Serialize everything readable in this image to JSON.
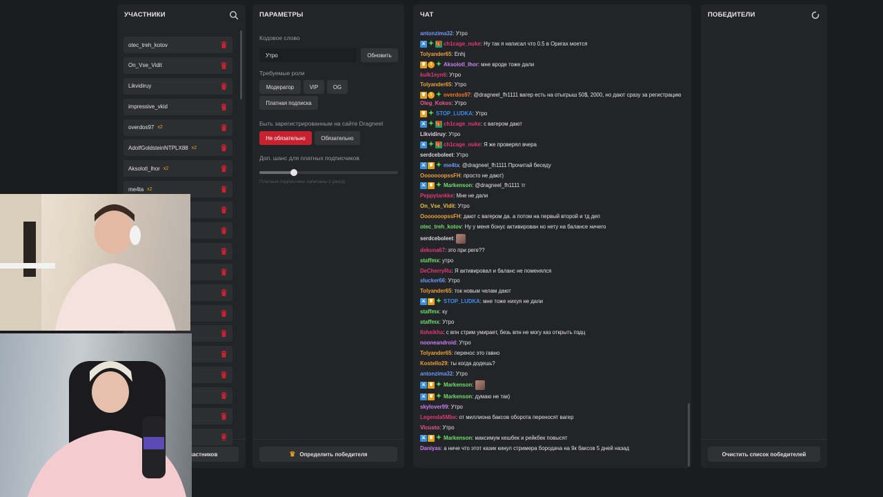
{
  "participants": {
    "title": "УЧАСТНИКИ",
    "items": [
      {
        "name": "otec_treh_kotov",
        "mult": ""
      },
      {
        "name": "On_Vse_Vidit",
        "mult": ""
      },
      {
        "name": "Likvidiruy",
        "mult": ""
      },
      {
        "name": "impressive_vkid",
        "mult": ""
      },
      {
        "name": "overdos97",
        "mult": "x2"
      },
      {
        "name": "AdolfGoldsteinNTPLX88",
        "mult": "x2"
      },
      {
        "name": "Aksolotl_lhor",
        "mult": "x2"
      },
      {
        "name": "me4ta",
        "mult": "x2"
      },
      {
        "name": "",
        "mult": ""
      },
      {
        "name": "",
        "mult": ""
      },
      {
        "name": "",
        "mult": ""
      },
      {
        "name": "",
        "mult": ""
      },
      {
        "name": "",
        "mult": ""
      },
      {
        "name": "",
        "mult": ""
      },
      {
        "name": "",
        "mult": ""
      },
      {
        "name": "",
        "mult": ""
      },
      {
        "name": "",
        "mult": ""
      },
      {
        "name": "",
        "mult": ""
      },
      {
        "name": "",
        "mult": ""
      },
      {
        "name": "",
        "mult": ""
      }
    ],
    "footer_button": "участников"
  },
  "params": {
    "title": "ПАРАМЕТРЫ",
    "keyword_label": "Кодовое слово",
    "keyword_value": "Утро",
    "update_button": "Обновить",
    "roles_label": "Требуемые роли",
    "roles": [
      "Модератор",
      "VIP",
      "OG",
      "Платная подписка"
    ],
    "registered_label": "Быть зарегистрированным на сайте Dragneel",
    "registered_options": [
      "Не обязательно",
      "Обязательно"
    ],
    "registered_selected": "Не обязательно",
    "chance_label": "Доп. шанс для платных подписчиков",
    "chance_level": 0.25,
    "chance_hint": "Платные подписчики записаны 2 раз(а)",
    "footer_button": "Определить победителя"
  },
  "chat": {
    "title": "ЧАТ",
    "messages": [
      {
        "badges": [],
        "nick": "antonzima32",
        "color": "#6c9cf5",
        "text": "Утро"
      },
      {
        "badges": [
          "mod",
          "star",
          "gift"
        ],
        "nick": "ch1cage_nuke",
        "color": "#e03a72",
        "text": "Ну так я написал что 0.5 в Оригах моется"
      },
      {
        "badges": [],
        "nick": "Tolyander65",
        "color": "#e8a33a",
        "text": "Enhj"
      },
      {
        "badges": [
          "crown",
          "sub",
          "star"
        ],
        "nick": "Aksolotl_lhor",
        "color": "#c783f2",
        "text": "мне вроде тоже дали"
      },
      {
        "badges": [],
        "nick": "kulk1eyn6",
        "color": "#e03a72",
        "text": "Утро"
      },
      {
        "badges": [],
        "nick": "Tolyander65",
        "color": "#e8a33a",
        "text": "Утро"
      },
      {
        "badges": [
          "crown",
          "sub",
          "star"
        ],
        "nick": "overdos97",
        "color": "#f07b2c",
        "text": "@dragneel_fh1111 вагер есть на отыгрыш 50$, 2000, но дают сразу за регистрацию"
      },
      {
        "badges": [],
        "nick": "Oleg_Kokos",
        "color": "#ea5c8c",
        "text": "Утро"
      },
      {
        "badges": [
          "crown",
          "star"
        ],
        "nick": "STOP_LUDKA",
        "color": "#3c8ef3",
        "text": "Утро"
      },
      {
        "badges": [
          "mod",
          "star",
          "gift"
        ],
        "nick": "ch1cage_nuke",
        "color": "#e03a72",
        "text": "с вагером дают"
      },
      {
        "badges": [],
        "nick": "Likvidiruy",
        "color": "#d7d7d7",
        "text": "Утро"
      },
      {
        "badges": [
          "mod",
          "star",
          "gift"
        ],
        "nick": "ch1cage_nuke",
        "color": "#e03a72",
        "text": "Я же проверял вчера"
      },
      {
        "badges": [],
        "nick": "serdceboleet",
        "color": "#d7d7d7",
        "text": "Утро"
      },
      {
        "badges": [
          "mod",
          "crown",
          "star"
        ],
        "nick": "me4ta",
        "color": "#6c9cf5",
        "text": "@dragneel_fh1111 Прочитай беседу"
      },
      {
        "badges": [],
        "nick": "OoooooopssFH",
        "color": "#e8a33a",
        "text": "просто не дают)"
      },
      {
        "badges": [
          "mod",
          "crown",
          "star"
        ],
        "nick": "Markenson",
        "color": "#6ee06e",
        "text": "@dragneel_fh1111 тг"
      },
      {
        "badges": [],
        "nick": "Peppytankke",
        "color": "#e03a72",
        "text": "Мне не дали"
      },
      {
        "badges": [],
        "nick": "On_Vse_Vidit",
        "color": "#e8c23a",
        "text": "Утро"
      },
      {
        "badges": [],
        "nick": "OoooooopssFH",
        "color": "#e8a33a",
        "text": "дают с вагером да. а потом на первый второй и тд деп"
      },
      {
        "badges": [],
        "nick": "otec_treh_kotov",
        "color": "#6ee06e",
        "text": "Ну у меня бонус активирован но нету на балансе ничего"
      },
      {
        "badges": [],
        "nick": "serdceboleet",
        "color": "#d7d7d7",
        "text": "",
        "emote": true
      },
      {
        "badges": [],
        "nick": "dekuna67",
        "color": "#e03a72",
        "text": "это при реге??"
      },
      {
        "badges": [],
        "nick": "staffmx",
        "color": "#6ee06e",
        "text": "утро"
      },
      {
        "badges": [],
        "nick": "DeCherryRu",
        "color": "#e03a72",
        "text": "Я активировал и баланс не поменялся"
      },
      {
        "badges": [],
        "nick": "slucker66",
        "color": "#6c9cf5",
        "text": "Утро"
      },
      {
        "badges": [],
        "nick": "Tolyander65",
        "color": "#e8a33a",
        "text": "ток новым челам дают"
      },
      {
        "badges": [
          "mod",
          "crown",
          "star"
        ],
        "nick": "STOP_LUDKA",
        "color": "#3c8ef3",
        "text": "мне тоже нихуя не дали"
      },
      {
        "badges": [],
        "nick": "staffmx",
        "color": "#6ee06e",
        "text": "ку"
      },
      {
        "badges": [],
        "nick": "staffmx",
        "color": "#6ee06e",
        "text": "Утро"
      },
      {
        "badges": [],
        "nick": "Ilsheikha",
        "color": "#e03a72",
        "text": "с впн стрим умирает, безь впн не могу каз открыть пздц"
      },
      {
        "badges": [],
        "nick": "nooneandroid",
        "color": "#c783f2",
        "text": "Утро"
      },
      {
        "badges": [],
        "nick": "Tolyander65",
        "color": "#e8a33a",
        "text": "перенос это гавно"
      },
      {
        "badges": [],
        "nick": "Kostello29",
        "color": "#e8a33a",
        "text": "ты когда додешь?"
      },
      {
        "badges": [],
        "nick": "antonzima32",
        "color": "#6c9cf5",
        "text": "Утро"
      },
      {
        "badges": [
          "mod",
          "crown",
          "star"
        ],
        "nick": "Markenson",
        "color": "#6ee06e",
        "text": "",
        "emote": true
      },
      {
        "badges": [
          "mod",
          "crown",
          "star"
        ],
        "nick": "Markenson",
        "color": "#6ee06e",
        "text": "думаю не так)"
      },
      {
        "badges": [],
        "nick": "skylover99",
        "color": "#c783f2",
        "text": "Утро"
      },
      {
        "badges": [],
        "nick": "Legenda5Mbe",
        "color": "#e03a72",
        "text": "от миллиона баксов оборота переносят вагер"
      },
      {
        "badges": [],
        "nick": "Vicusto",
        "color": "#ea5c8c",
        "text": "Утро"
      },
      {
        "badges": [
          "mod",
          "crown",
          "star"
        ],
        "nick": "Markenson",
        "color": "#6ee06e",
        "text": "максимум кешбек и рейкбек повысят"
      },
      {
        "badges": [],
        "nick": "Daniyas",
        "color": "#c783f2",
        "text": "а ниче что этот казик кинул стримера бородача на 9к баксов 5 дней назад"
      }
    ]
  },
  "winners": {
    "title": "ПОБЕДИТЕЛИ",
    "footer_button": "Очистить список победителей"
  },
  "colors": {
    "accent_red": "#c7222f",
    "panel_bg": "#232427",
    "page_bg": "#1b1c1f"
  }
}
